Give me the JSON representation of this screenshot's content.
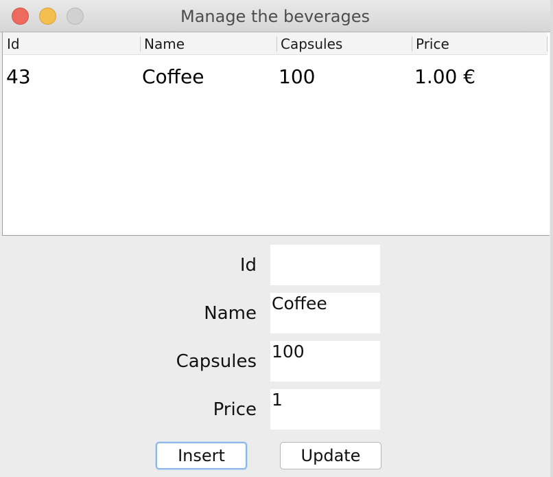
{
  "window": {
    "title": "Manage the beverages"
  },
  "table": {
    "columns": [
      "Id",
      "Name",
      "Capsules",
      "Price"
    ],
    "rows": [
      [
        "43",
        "Coffee",
        "100",
        "1.00 €"
      ]
    ]
  },
  "form": {
    "id_label": "Id",
    "id_value": "",
    "name_label": "Name",
    "name_value": "Coffee",
    "capsules_label": "Capsules",
    "capsules_value": "100",
    "price_label": "Price",
    "price_value": "1"
  },
  "buttons": {
    "insert_label": "Insert",
    "update_label": "Update"
  },
  "colors": {
    "close": "#ed6a5e",
    "minimize": "#f5bf4f",
    "maximize": "#d1d1d1",
    "focus_ring": "#8fb7e6"
  }
}
